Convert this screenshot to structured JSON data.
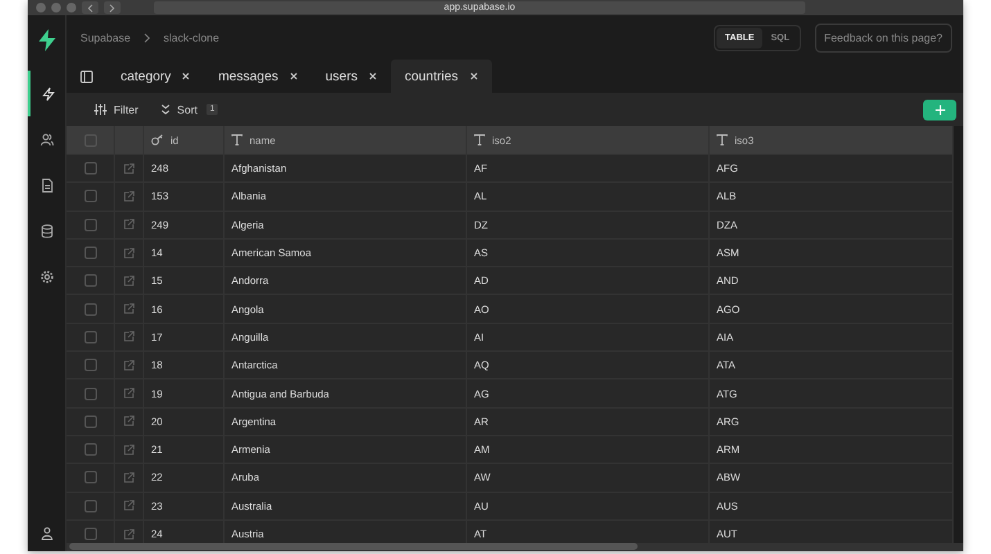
{
  "browser": {
    "url": "app.supabase.io"
  },
  "sidebar": {
    "items": [
      {
        "kind": "bolt",
        "selected": true
      },
      {
        "kind": "users",
        "selected": false
      },
      {
        "kind": "document",
        "selected": false
      },
      {
        "kind": "database",
        "selected": false
      },
      {
        "kind": "settings",
        "selected": false
      }
    ]
  },
  "breadcrumb": [
    "Supabase",
    "slack-clone"
  ],
  "view_toggle": [
    {
      "label": "TABLE",
      "selected": true
    },
    {
      "label": "SQL",
      "selected": false
    }
  ],
  "feedback_button": "Feedback on this page?",
  "tabs": [
    {
      "label": "category",
      "selected": false
    },
    {
      "label": "messages",
      "selected": false
    },
    {
      "label": "users",
      "selected": false
    },
    {
      "label": "countries",
      "selected": true
    }
  ],
  "toolbar": {
    "filter": "Filter",
    "sort": "Sort",
    "sort_count": "1"
  },
  "table": {
    "select_all_checked": false,
    "columns": [
      {
        "name": "id",
        "kind": "key"
      },
      {
        "name": "name",
        "kind": "text"
      },
      {
        "name": "iso2",
        "kind": "text"
      },
      {
        "name": "iso3",
        "kind": "text"
      }
    ],
    "rows": [
      {
        "checked": false,
        "cells": [
          "248",
          "Afghanistan",
          "AF",
          "AFG"
        ]
      },
      {
        "checked": false,
        "cells": [
          "153",
          "Albania",
          "AL",
          "ALB"
        ]
      },
      {
        "checked": false,
        "cells": [
          "249",
          "Algeria",
          "DZ",
          "DZA"
        ]
      },
      {
        "checked": false,
        "cells": [
          "14",
          "American Samoa",
          "AS",
          "ASM"
        ]
      },
      {
        "checked": false,
        "cells": [
          "15",
          "Andorra",
          "AD",
          "AND"
        ]
      },
      {
        "checked": false,
        "cells": [
          "16",
          "Angola",
          "AO",
          "AGO"
        ]
      },
      {
        "checked": false,
        "cells": [
          "17",
          "Anguilla",
          "AI",
          "AIA"
        ]
      },
      {
        "checked": false,
        "cells": [
          "18",
          "Antarctica",
          "AQ",
          "ATA"
        ]
      },
      {
        "checked": false,
        "cells": [
          "19",
          "Antigua and Barbuda",
          "AG",
          "ATG"
        ]
      },
      {
        "checked": false,
        "cells": [
          "20",
          "Argentina",
          "AR",
          "ARG"
        ]
      },
      {
        "checked": false,
        "cells": [
          "21",
          "Armenia",
          "AM",
          "ARM"
        ]
      },
      {
        "checked": false,
        "cells": [
          "22",
          "Aruba",
          "AW",
          "ABW"
        ]
      },
      {
        "checked": false,
        "cells": [
          "23",
          "Australia",
          "AU",
          "AUS"
        ]
      },
      {
        "checked": false,
        "cells": [
          "24",
          "Austria",
          "AT",
          "AUT"
        ]
      }
    ]
  }
}
